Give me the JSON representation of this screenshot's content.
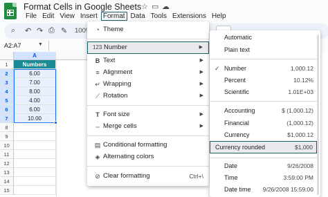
{
  "title": "Format Cells in Google Sheets",
  "title_icons": [
    "star-icon",
    "move-to-folder-icon",
    "cloud-status-icon"
  ],
  "menubar": [
    "File",
    "Edit",
    "View",
    "Insert",
    "Format",
    "Data",
    "Tools",
    "Extensions",
    "Help"
  ],
  "active_menu": "Format",
  "toolbar": {
    "zoom": "100%"
  },
  "namebox": "A2:A7",
  "grid": {
    "column_header": "A",
    "row_headers": [
      "1",
      "2",
      "3",
      "4",
      "5",
      "6",
      "7",
      "8",
      "9",
      "10",
      "11",
      "12",
      "13",
      "14",
      "15"
    ],
    "cells": [
      "Numbers",
      "6.00",
      "7.00",
      "8.00",
      "4.00",
      "6.00",
      "10.00"
    ]
  },
  "format_menu": {
    "items": [
      {
        "icon": "palette-icon",
        "label": "Theme",
        "arrow": false
      },
      {
        "icon": "number-format-icon",
        "label": "Number",
        "arrow": true,
        "highlight": true
      },
      {
        "icon": "bold-icon",
        "label": "Text",
        "arrow": true
      },
      {
        "icon": "align-left-icon",
        "label": "Alignment",
        "arrow": true
      },
      {
        "icon": "wrap-icon",
        "label": "Wrapping",
        "arrow": true
      },
      {
        "icon": "rotation-icon",
        "label": "Rotation",
        "arrow": true
      },
      {
        "icon": "font-size-icon",
        "label": "Font size",
        "arrow": true
      },
      {
        "icon": "merge-cells-icon",
        "label": "Merge cells",
        "arrow": true
      },
      {
        "icon": "conditional-format-icon",
        "label": "Conditional formatting",
        "arrow": false
      },
      {
        "icon": "alternating-colors-icon",
        "label": "Alternating colors",
        "arrow": false
      },
      {
        "icon": "clear-format-icon",
        "label": "Clear formatting",
        "arrow": false,
        "shortcut": "Ctrl+\\"
      }
    ]
  },
  "number_submenu": {
    "items": [
      {
        "label": "Automatic",
        "example": ""
      },
      {
        "label": "Plain text",
        "example": ""
      },
      {
        "label": "Number",
        "example": "1,000.12",
        "checked": true
      },
      {
        "label": "Percent",
        "example": "10.12%"
      },
      {
        "label": "Scientific",
        "example": "1.01E+03"
      },
      {
        "label": "Accounting",
        "example": "$ (1,000.12)"
      },
      {
        "label": "Financial",
        "example": "(1,000.12)"
      },
      {
        "label": "Currency",
        "example": "$1,000.12"
      },
      {
        "label": "Currency rounded",
        "example": "$1,000",
        "highlight": true
      },
      {
        "label": "Date",
        "example": "9/26/2008"
      },
      {
        "label": "Time",
        "example": "3:59:00 PM"
      },
      {
        "label": "Date time",
        "example": "9/26/2008 15:59:00"
      }
    ]
  },
  "colors": {
    "header_fill": "#1b8a95",
    "value_fill": "#e8effd",
    "selection": "#1a73e8",
    "highlight_border": "#1b5e6b"
  }
}
